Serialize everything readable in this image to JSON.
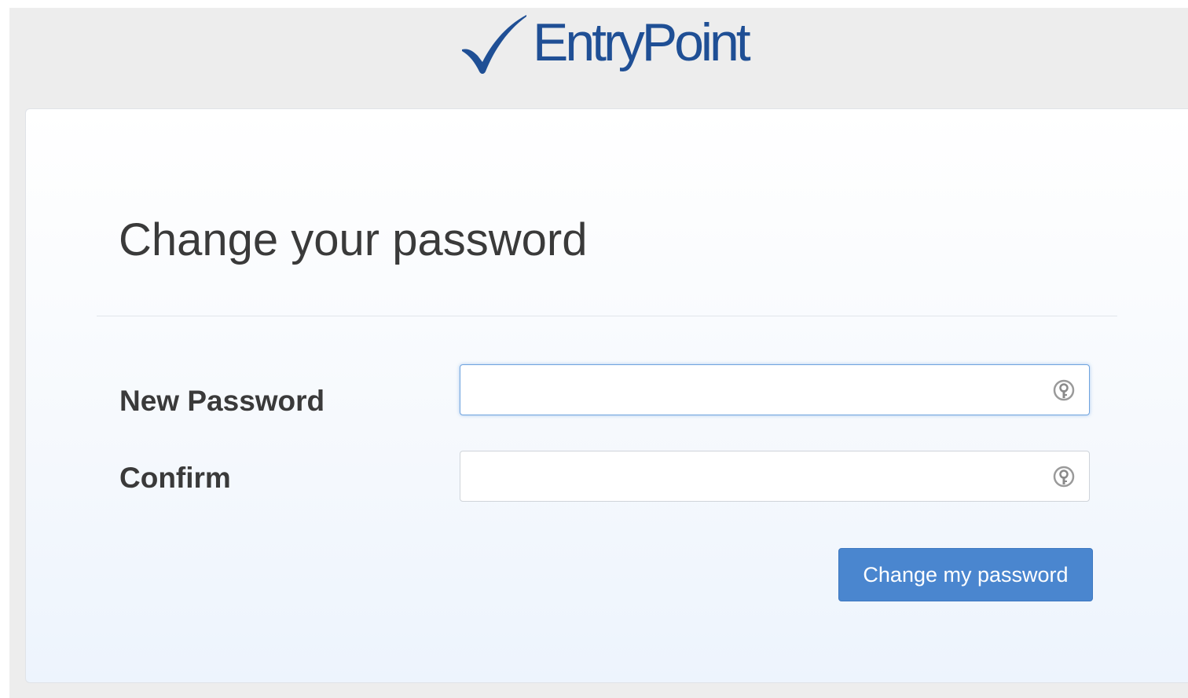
{
  "brand": {
    "logo_text": "EntryPoint",
    "logo_icon": "checkmark-icon",
    "color": "#1f4f95"
  },
  "form": {
    "title": "Change your password",
    "new_password_label": "New Password",
    "new_password_value": "",
    "confirm_label": "Confirm",
    "confirm_value": "",
    "field_icon": "password-key-icon",
    "submit_label": "Change my password"
  },
  "colors": {
    "button": "#4a86cf",
    "focus_ring": "#6fa3de",
    "page_background": "#ededed"
  }
}
